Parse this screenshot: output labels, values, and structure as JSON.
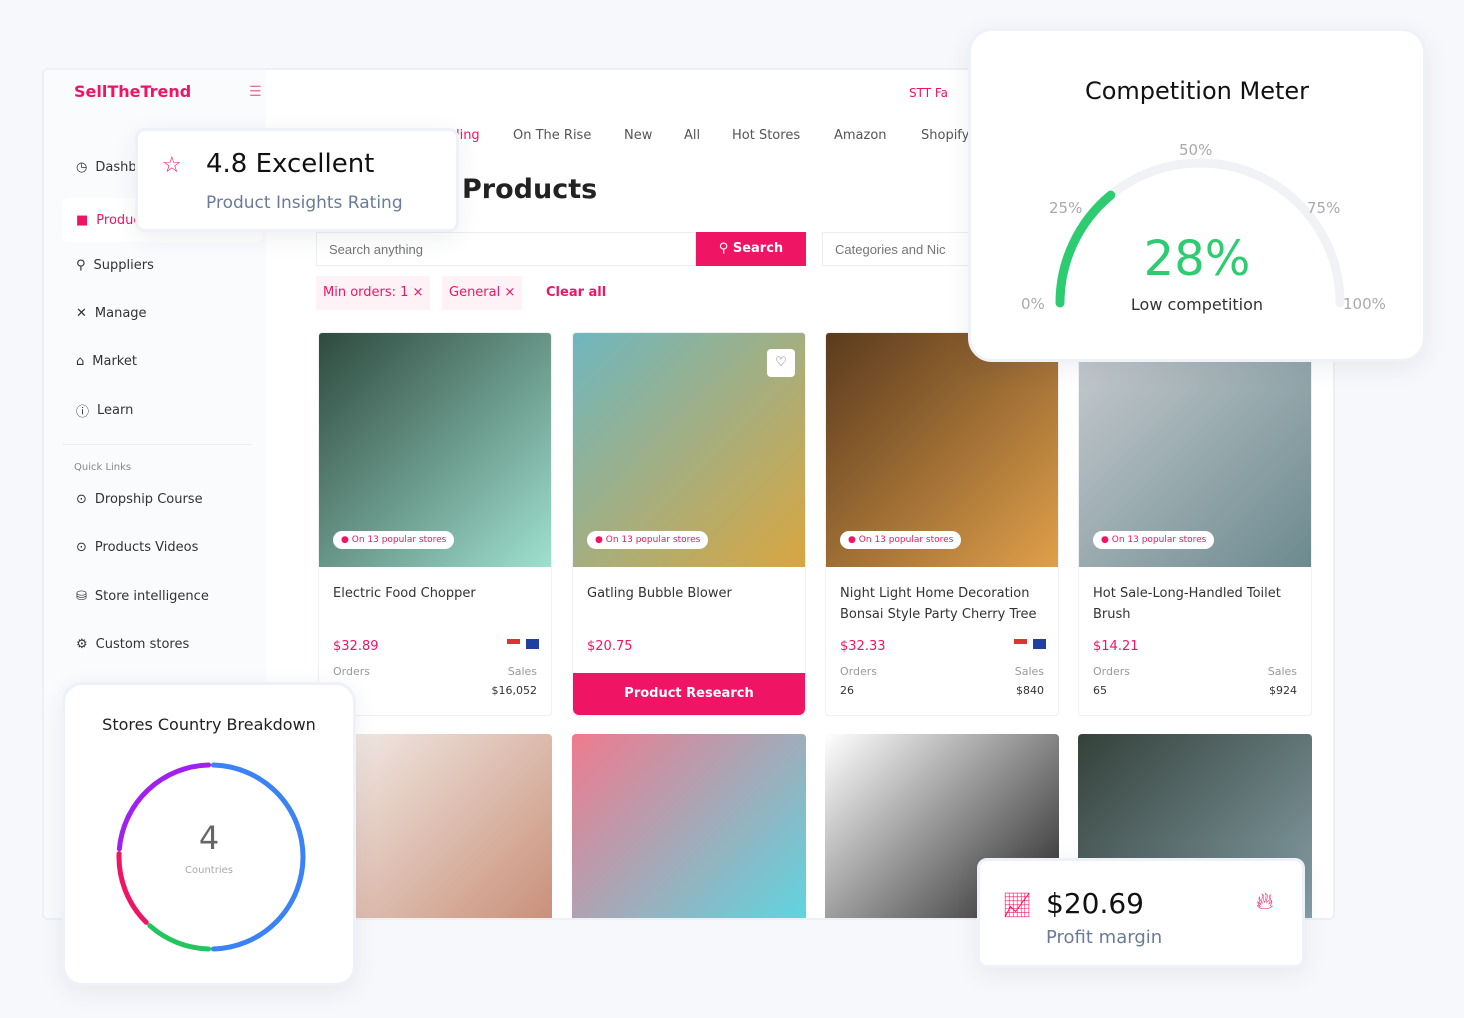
{
  "app": {
    "logo": "SellTheTrend",
    "top_right": "STT Fa"
  },
  "sidebar": {
    "items": [
      {
        "label": "Dashboard",
        "icon": "gauge-icon"
      },
      {
        "label": "Products",
        "icon": "bag-icon",
        "active": true
      },
      {
        "label": "Suppliers",
        "icon": "location-icon"
      },
      {
        "label": "Manage",
        "icon": "tools-icon"
      },
      {
        "label": "Market",
        "icon": "home-icon"
      },
      {
        "label": "Learn",
        "icon": "info-icon"
      }
    ],
    "quick_links_title": "Quick Links",
    "quick_links": [
      {
        "label": "Dropship Course",
        "icon": "play-circle-icon"
      },
      {
        "label": "Products Videos",
        "icon": "play-circle-icon"
      },
      {
        "label": "Store intelligence",
        "icon": "store-icon"
      },
      {
        "label": "Custom stores",
        "icon": "gear-icon"
      }
    ]
  },
  "tabs": [
    "Trending",
    "On The Rise",
    "New",
    "All",
    "Hot Stores",
    "Amazon",
    "Shopify"
  ],
  "page_title": "Products",
  "search": {
    "placeholder": "Search anything",
    "button": "Search",
    "categories_placeholder": "Categories and Nic"
  },
  "filters": [
    "Min orders: 1 ×",
    "General ×"
  ],
  "clear_all": "Clear all",
  "products": [
    {
      "name": "Electric Food Chopper",
      "badge": "On 13 popular stores",
      "price": "$32.89",
      "orders_label": "Orders",
      "orders": "",
      "sales_label": "Sales",
      "sales": "$16,052",
      "colors": [
        "#2f4a3f",
        "#9fe0cf"
      ]
    },
    {
      "name": "Gatling Bubble Blower",
      "badge": "On 13 popular stores",
      "price": "$20.75",
      "button": "Product Research",
      "colors": [
        "#6fb7c0",
        "#d9a640"
      ]
    },
    {
      "name": "Night Light Home Decoration Bonsai Style Party Cherry Tree",
      "badge": "On 13 popular stores",
      "price": "$32.33",
      "orders_label": "Orders",
      "orders": "26",
      "sales_label": "Sales",
      "sales": "$840",
      "colors": [
        "#5a3a1e",
        "#e0a04a"
      ]
    },
    {
      "name": "Hot Sale-Long-Handled Toilet Brush",
      "badge": "On 13 popular stores",
      "price": "$14.21",
      "orders_label": "Orders",
      "orders": "65",
      "sales_label": "Sales",
      "sales": "$924",
      "colors": [
        "#c8ccd0",
        "#6c8a8f"
      ]
    }
  ],
  "products_row2_colors": [
    [
      "#f3efec",
      "#c98f78"
    ],
    [
      "#f07a8e",
      "#5cd6e0"
    ],
    [
      "#ffffff",
      "#222222"
    ],
    [
      "#34413a",
      "#86a0a8"
    ]
  ],
  "rating_card": {
    "score": "4.8 Excellent",
    "subtitle": "Product Insights Rating"
  },
  "competition_meter": {
    "title": "Competition Meter",
    "value_percent": 28,
    "value": "28%",
    "label": "Low competition",
    "ticks": [
      "0%",
      "25%",
      "50%",
      "75%",
      "100%"
    ],
    "accent": "#2ecc71"
  },
  "stores_breakdown": {
    "title": "Stores Country Breakdown",
    "count": "4",
    "count_label": "Countries",
    "segments": [
      {
        "color": "#3b82f6",
        "share": 50
      },
      {
        "color": "#22c55e",
        "share": 12
      },
      {
        "color": "#f01464",
        "share": 14
      },
      {
        "color": "#a020f0",
        "share": 24
      }
    ]
  },
  "profit_card": {
    "value": "$20.69",
    "label": "Profit margin"
  },
  "colors": {
    "brand": "#f01464"
  }
}
